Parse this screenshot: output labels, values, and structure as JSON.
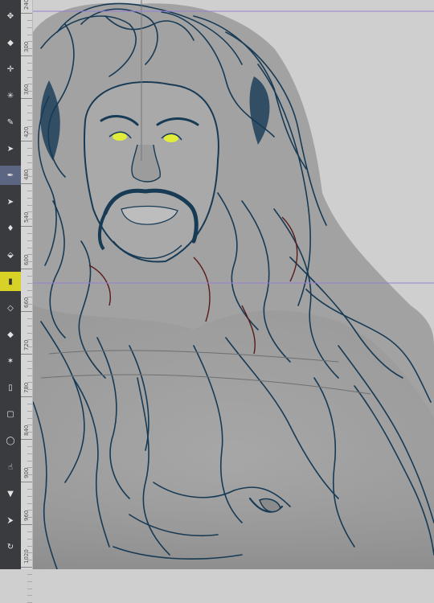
{
  "toolbar": {
    "tools": [
      {
        "name": "move-tool",
        "glyph": "✥"
      },
      {
        "name": "transform-tool",
        "glyph": "◆"
      },
      {
        "name": "crop-tool",
        "glyph": "✛"
      },
      {
        "name": "magic-wand-tool",
        "glyph": "✳"
      },
      {
        "name": "eyedropper-tool",
        "glyph": "✎"
      },
      {
        "name": "brush-tool",
        "glyph": "➤"
      },
      {
        "name": "pen-tool",
        "glyph": "✒",
        "active": true
      },
      {
        "name": "pencil-tool",
        "glyph": "➤"
      },
      {
        "name": "ink-tool",
        "glyph": "♦"
      },
      {
        "name": "fill-tool",
        "glyph": "⬙"
      },
      {
        "name": "gradient-tool",
        "glyph": "▮",
        "highlight": true
      },
      {
        "name": "blend-tool",
        "glyph": "◇"
      },
      {
        "name": "erase-tool",
        "glyph": "◆"
      },
      {
        "name": "text-tool",
        "glyph": "✶"
      },
      {
        "name": "figure-tool",
        "glyph": "▯"
      },
      {
        "name": "frame-tool",
        "glyph": "▢"
      },
      {
        "name": "lasso-tool",
        "glyph": "◯"
      },
      {
        "name": "hand-tool",
        "glyph": "☝"
      },
      {
        "name": "zoom-tool",
        "glyph": "▼"
      },
      {
        "name": "vector-tool",
        "glyph": "⮞"
      },
      {
        "name": "rotate-tool",
        "glyph": "↻"
      }
    ]
  },
  "ruler": {
    "labels": [
      "240",
      "300",
      "360",
      "420",
      "480",
      "540",
      "600",
      "660",
      "720",
      "780",
      "840",
      "900",
      "960",
      "1020"
    ]
  },
  "canvas": {
    "guide_color": "#9b7fd8",
    "ink_color": "#173a55",
    "eye_color": "#e2ec3a",
    "red_line_color": "#5a1a1a"
  }
}
